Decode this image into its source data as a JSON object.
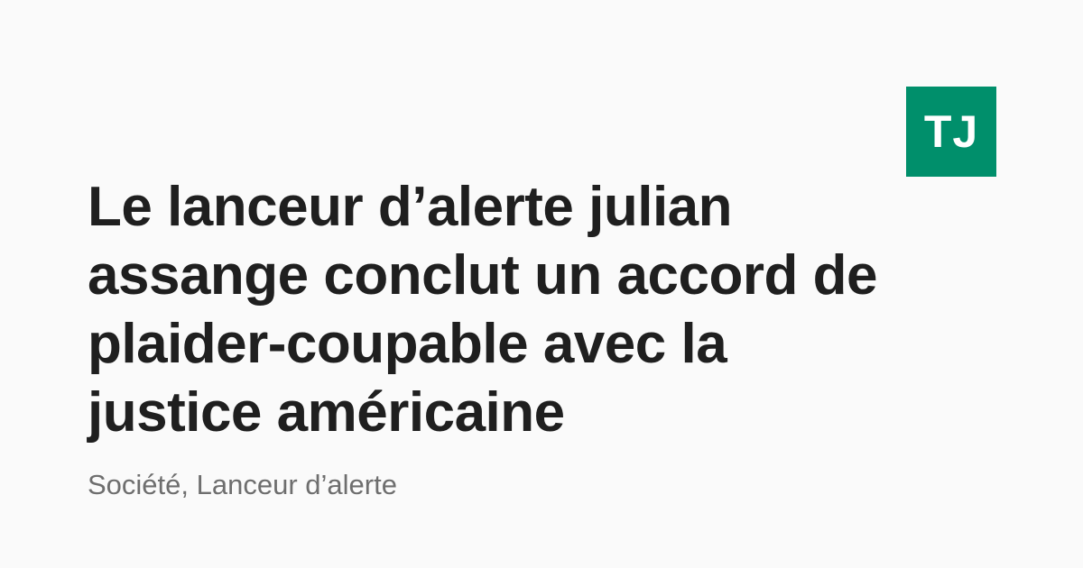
{
  "logo": {
    "text": "TJ",
    "color": "#008f6b"
  },
  "article": {
    "title": "Le lanceur d’alerte julian assange conclut un accord de plaider-coupable avec la justice américaine",
    "categories": "Société, Lanceur d’alerte"
  }
}
